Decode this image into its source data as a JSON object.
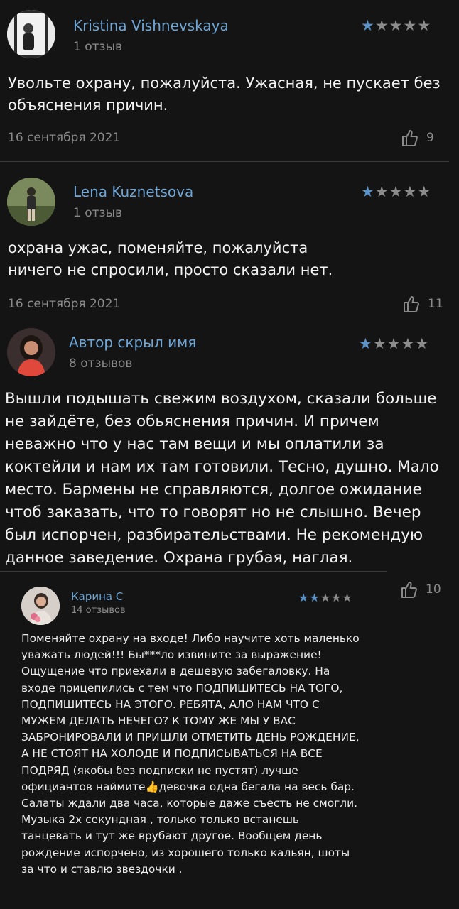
{
  "reviews": [
    {
      "author": "Kristina Vishnevskaya",
      "review_count": "1 отзыв",
      "rating": 1,
      "text": "Увольте охрану, пожалуйста. Ужасная, не пускает без объяснения причин.",
      "date": "16 сентября 2021",
      "likes": "9"
    },
    {
      "author": "Lena Kuznetsova",
      "review_count": "1 отзыв",
      "rating": 1,
      "text_line1": "охрана ужас, поменяйте, пожалуйста",
      "text_line2": "ничего не спросили, просто сказали нет.",
      "date": "16 сентября 2021",
      "likes": "11"
    },
    {
      "author": "Автор скрыл имя",
      "review_count": "8 отзывов",
      "rating": 1,
      "text": "Вышли подышать свежим воздухом, сказали больше не зайдёте, без обьяснения причин. И причем неважно что у нас там вещи и мы оплатили за коктейли и нам их там готовили. Тесно, душно. Мало место. Бармены не справляются, долгое ожидание чтоб заказать, что то говорят но не слышно. Вечер был испорчен, разбирательствами. Не рекомендую данное заведение. Охрана грубая, наглая."
    },
    {
      "author": "Карина С",
      "review_count": "14 отзывов",
      "rating": 2,
      "likes": "10",
      "text_part1": "Поменяйте охрану на входе! Либо научите хоть маленько уважать людей!!! Бы***ло извините за выражение! Ощущение что приехали в дешевую забегаловку. На входе прицепились с тем что ПОДПИШИТЕСЬ НА ТОГО, ПОДПИШИТЕСЬ НА ЭТОГО. РЕБЯТА, АЛО НАМ ЧТО С МУЖЕМ ДЕЛАТЬ НЕЧЕГО? К ТОМУ ЖЕ МЫ У ВАС ЗАБРОНИРОВАЛИ И ПРИШЛИ ОТМЕТИТЬ ДЕНЬ РОЖДЕНИЕ, А НЕ СТОЯТ НА ХОЛОДЕ И ПОДПИСЫВАТЬСЯ НА ВСЕ ПОДРЯД (якобы без подписки не пустят) лучше официантов наймите",
      "emoji": "👍",
      "text_part2": "девочка одна бегала на весь бар. Салаты ждали два часа, которые даже съесть не смогли. Музыка 2х секундная , только только встанешь танцевать и тут же врубают другое. Вообщем день рождение испорчено, из хорошего только кальян, шоты за что и ставлю звездочки ."
    }
  ],
  "icons": {
    "star": "star-icon",
    "like": "thumb-up-icon"
  },
  "colors": {
    "background": "#141414",
    "author_name": "#6fa6d6",
    "star_active": "#5b93c8",
    "star_inactive": "#8c8c8c",
    "secondary_text": "#8a8a8a"
  }
}
